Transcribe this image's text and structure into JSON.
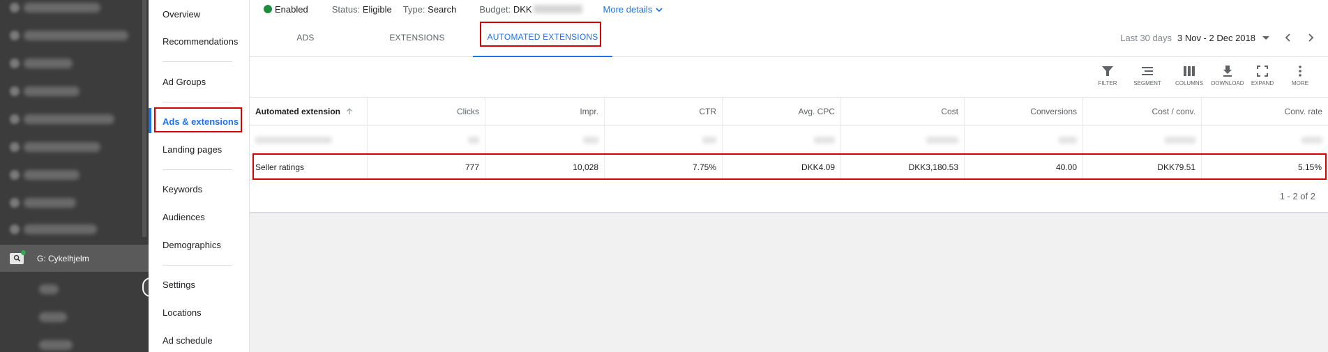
{
  "left_nav": {
    "campaign_name": "G: Cykelhjelm"
  },
  "page_menu": {
    "items": [
      "Overview",
      "Recommendations",
      "Ad Groups",
      "Ads & extensions",
      "Landing pages",
      "Keywords",
      "Audiences",
      "Demographics",
      "Settings",
      "Locations",
      "Ad schedule"
    ],
    "active_index": 3
  },
  "status_bar": {
    "enabled": "Enabled",
    "status_label": "Status:",
    "status_value": "Eligible",
    "type_label": "Type:",
    "type_value": "Search",
    "budget_label": "Budget:",
    "budget_value": "DKK",
    "more_details": "More details"
  },
  "tabs": [
    {
      "label": "ADS"
    },
    {
      "label": "EXTENSIONS"
    },
    {
      "label": "AUTOMATED EXTENSIONS"
    }
  ],
  "active_tab": 2,
  "date_range": {
    "label": "Last 30 days",
    "value": "3 Nov - 2 Dec 2018"
  },
  "toolbar": {
    "filter": "FILTER",
    "segment": "SEGMENT",
    "columns": "COLUMNS",
    "download": "DOWNLOAD",
    "expand": "EXPAND",
    "more": "MORE"
  },
  "table": {
    "columns": [
      "Automated extension",
      "Clicks",
      "Impr.",
      "CTR",
      "Avg. CPC",
      "Cost",
      "Conversions",
      "Cost / conv.",
      "Conv. rate"
    ],
    "rows": [
      {
        "name": "Seller ratings",
        "clicks": "777",
        "impr": "10,028",
        "ctr": "7.75%",
        "avg_cpc": "DKK4.09",
        "cost": "DKK3,180.53",
        "conversions": "40.00",
        "cost_per_conv": "DKK79.51",
        "conv_rate": "5.15%"
      }
    ],
    "pagination": "1 - 2 of 2"
  },
  "colors": {
    "accent": "#1a73e8",
    "highlight": "#d50000",
    "enabled": "#1e8e3e",
    "sidebar": "#3c3c3c"
  }
}
